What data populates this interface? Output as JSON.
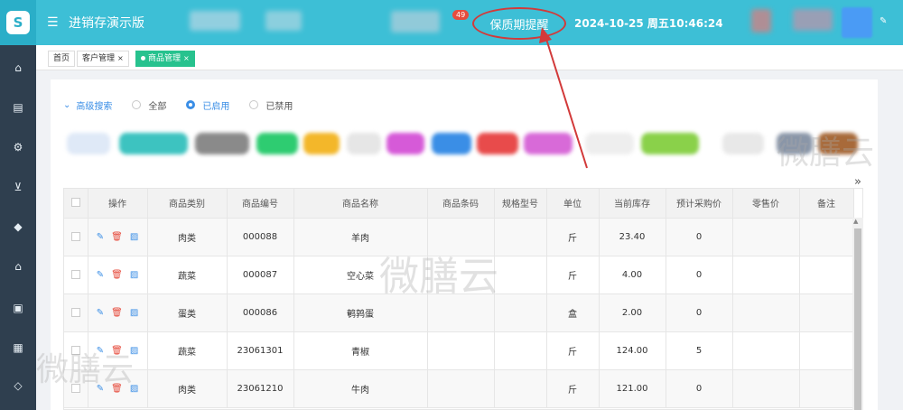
{
  "header": {
    "logo_letter": "S",
    "menu_icon": "menu-icon",
    "app_title": "进销存演示版",
    "badge_count": "49",
    "reminder_label": "保质期提醒",
    "datetime": "2024-10-25 周五10:46:24",
    "edit_icon": "edit-icon"
  },
  "sidebar": {
    "icons": [
      "home-icon",
      "inbox-icon",
      "gears-icon",
      "basket-icon",
      "tag-icon",
      "house-icon",
      "cash-icon",
      "report-icon",
      "shield-icon"
    ]
  },
  "tabs": [
    {
      "label": "首页",
      "closable": false,
      "active": false
    },
    {
      "label": "客户管理",
      "closable": true,
      "active": false
    },
    {
      "label": "商品管理",
      "closable": true,
      "active": true
    }
  ],
  "filter": {
    "advanced_search": "高级搜索",
    "options": [
      {
        "label": "全部",
        "selected": false
      },
      {
        "label": "已启用",
        "selected": true
      },
      {
        "label": "已禁用",
        "selected": false
      }
    ]
  },
  "category_chip_colors": [
    "#3dc3c0",
    "#8a8a8a",
    "#2ecc71",
    "#f3b72a",
    "#e6e6e6",
    "#d65ad8",
    "#3a8ee6",
    "#e84b4b",
    "#d86ad8",
    "#e6e6e6",
    "#8ad14a",
    "#e0e0e0",
    "#8a96a8",
    "#a86a3a"
  ],
  "table": {
    "columns": [
      "",
      "操作",
      "商品类别",
      "商品编号",
      "商品名称",
      "商品条码",
      "规格型号",
      "单位",
      "当前库存",
      "预计采购价",
      "零售价",
      "备注"
    ],
    "rows": [
      {
        "category": "肉类",
        "code": "000088",
        "name": "羊肉",
        "barcode": "",
        "spec": "",
        "unit": "斤",
        "stock": "23.40",
        "est_price": "0",
        "retail": "",
        "note": ""
      },
      {
        "category": "蔬菜",
        "code": "000087",
        "name": "空心菜",
        "barcode": "",
        "spec": "",
        "unit": "斤",
        "stock": "4.00",
        "est_price": "0",
        "retail": "",
        "note": ""
      },
      {
        "category": "蛋类",
        "code": "000086",
        "name": "鹌鹑蛋",
        "barcode": "",
        "spec": "",
        "unit": "盒",
        "stock": "2.00",
        "est_price": "0",
        "retail": "",
        "note": ""
      },
      {
        "category": "蔬菜",
        "code": "23061301",
        "name": "青椒",
        "barcode": "",
        "spec": "",
        "unit": "斤",
        "stock": "124.00",
        "est_price": "5",
        "retail": "",
        "note": ""
      },
      {
        "category": "肉类",
        "code": "23061210",
        "name": "牛肉",
        "barcode": "",
        "spec": "",
        "unit": "斤",
        "stock": "121.00",
        "est_price": "0",
        "retail": "",
        "note": ""
      }
    ]
  },
  "watermark_text": "微膳云",
  "colors": {
    "header": "#3dbfd6",
    "sidebar": "#2f3f4f",
    "active_tab": "#27c28e",
    "annotation": "#d23a3a",
    "link": "#3a8ee6"
  }
}
